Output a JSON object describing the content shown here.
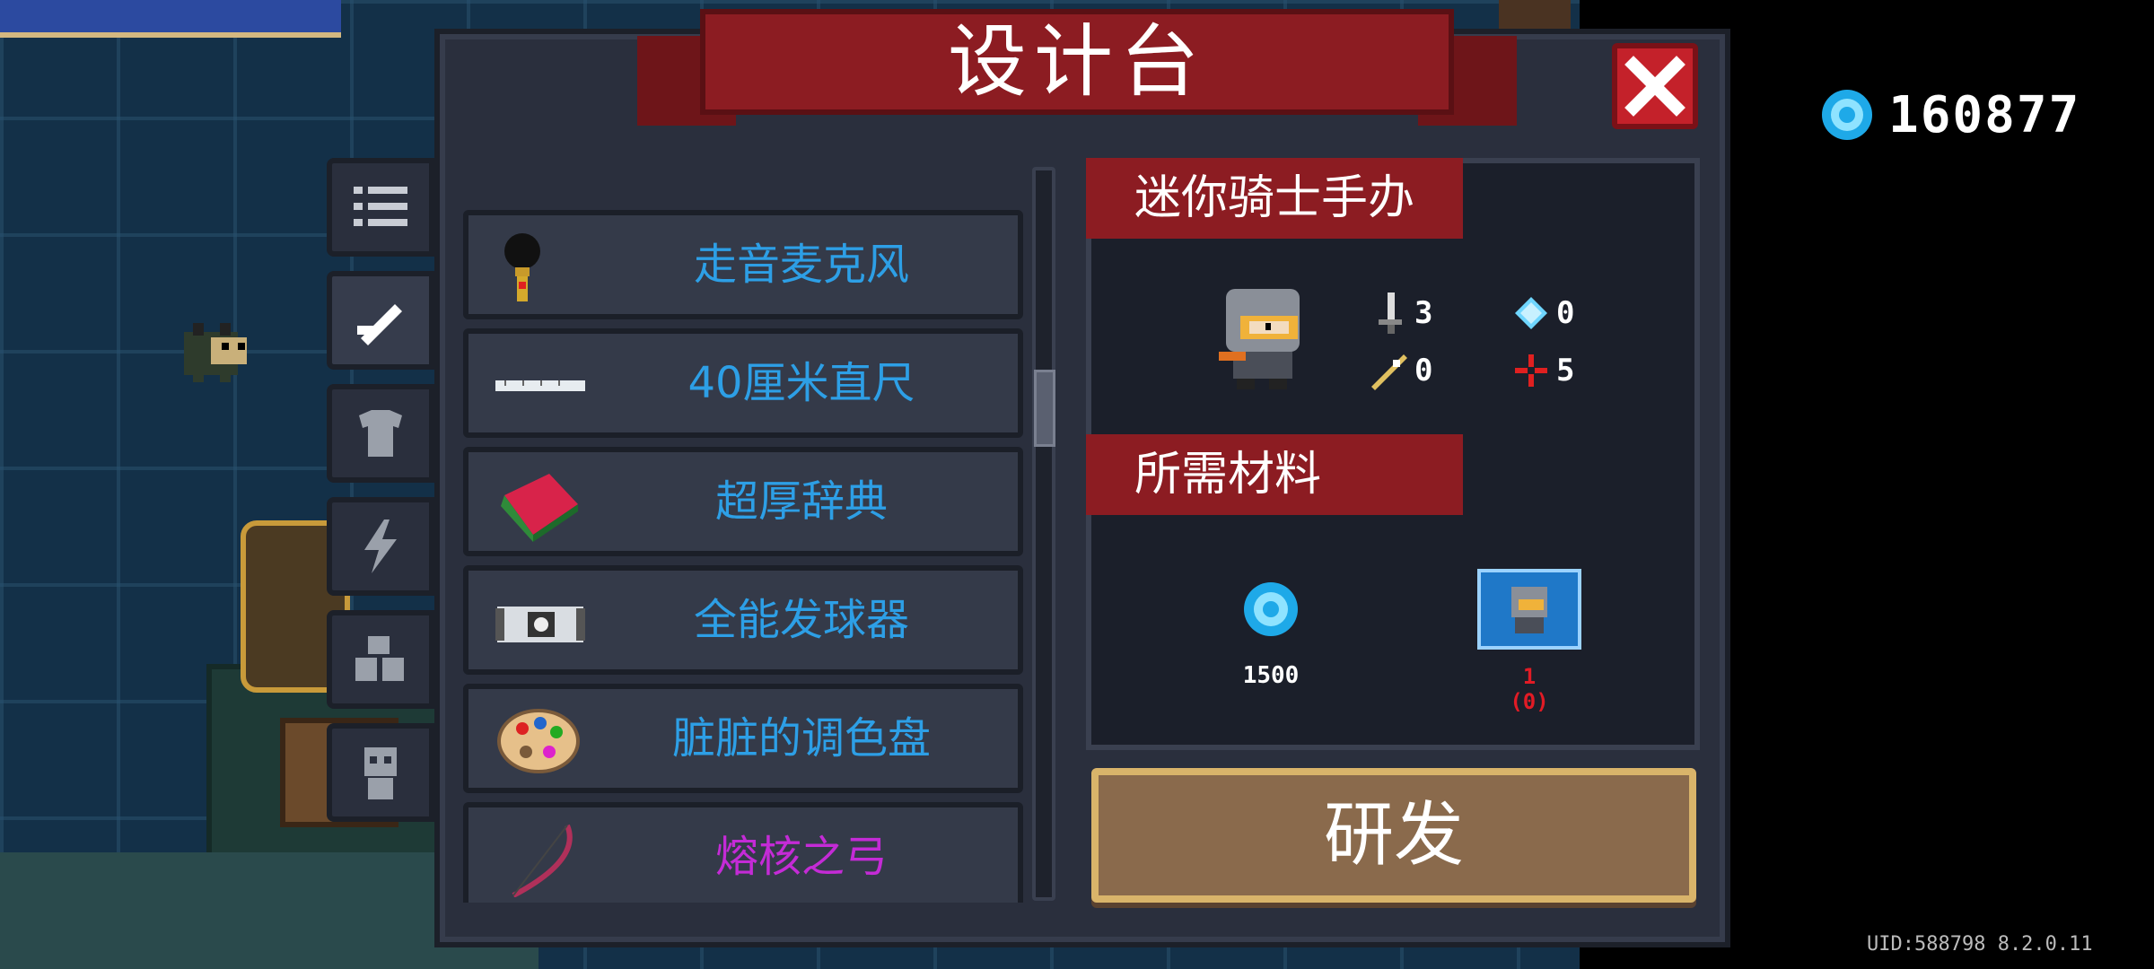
{
  "title": "设计台",
  "currency": {
    "amount": "160877",
    "icon": "gem-icon"
  },
  "uid_text": "UID:588798 8.2.0.11",
  "tabs": [
    {
      "icon": "list-icon",
      "active": false
    },
    {
      "icon": "weapon-icon",
      "active": true
    },
    {
      "icon": "armor-icon",
      "active": false
    },
    {
      "icon": "lightning-icon",
      "active": false
    },
    {
      "icon": "blocks-icon",
      "active": false
    },
    {
      "icon": "character-icon",
      "active": false
    }
  ],
  "items": [
    {
      "name": "走音麦克风",
      "icon": "microphone-icon",
      "color": "#2d9fe6"
    },
    {
      "name": "40厘米直尺",
      "icon": "ruler-icon",
      "color": "#2d9fe6"
    },
    {
      "name": "超厚辞典",
      "icon": "dictionary-icon",
      "color": "#2d9fe6"
    },
    {
      "name": "全能发球器",
      "icon": "ball-launcher-icon",
      "color": "#2d9fe6"
    },
    {
      "name": "脏脏的调色盘",
      "icon": "palette-icon",
      "color": "#2d9fe6"
    },
    {
      "name": "熔核之弓",
      "icon": "bow-icon",
      "color": "#c42bd6"
    }
  ],
  "detail": {
    "item_name": "迷你骑士手办",
    "stats": {
      "attack": "3",
      "energy": "0",
      "crit": "0",
      "accuracy": "5"
    },
    "materials_title": "所需材料",
    "materials": [
      {
        "icon": "gem-icon",
        "amount": "1500"
      },
      {
        "icon": "blueprint-icon",
        "amount": "1",
        "owned": "(0)"
      }
    ]
  },
  "develop_button": "研发"
}
